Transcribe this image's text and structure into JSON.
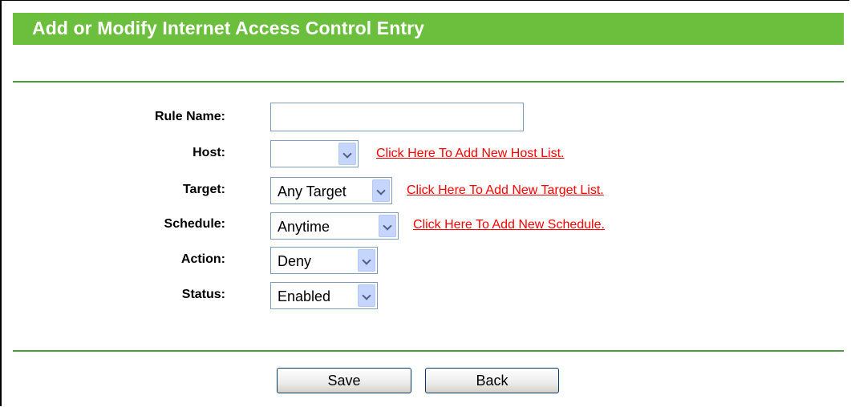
{
  "header": {
    "title": "Add or Modify Internet Access Control Entry"
  },
  "form": {
    "rule_name": {
      "label": "Rule Name:",
      "value": ""
    },
    "host": {
      "label": "Host:",
      "value": "",
      "link": "Click Here To Add New Host List."
    },
    "target": {
      "label": "Target:",
      "value": "Any Target",
      "link": "Click Here To Add New Target List."
    },
    "schedule": {
      "label": "Schedule:",
      "value": "Anytime",
      "link": "Click Here To Add New Schedule."
    },
    "action": {
      "label": "Action:",
      "value": "Deny"
    },
    "status": {
      "label": "Status:",
      "value": "Enabled"
    }
  },
  "buttons": {
    "save": "Save",
    "back": "Back"
  },
  "icons": {
    "dropdown": "chevron-down-icon"
  },
  "colors": {
    "title_bar": "#6bbf3c",
    "divider": "#4e9e40",
    "link": "#ff0000"
  }
}
